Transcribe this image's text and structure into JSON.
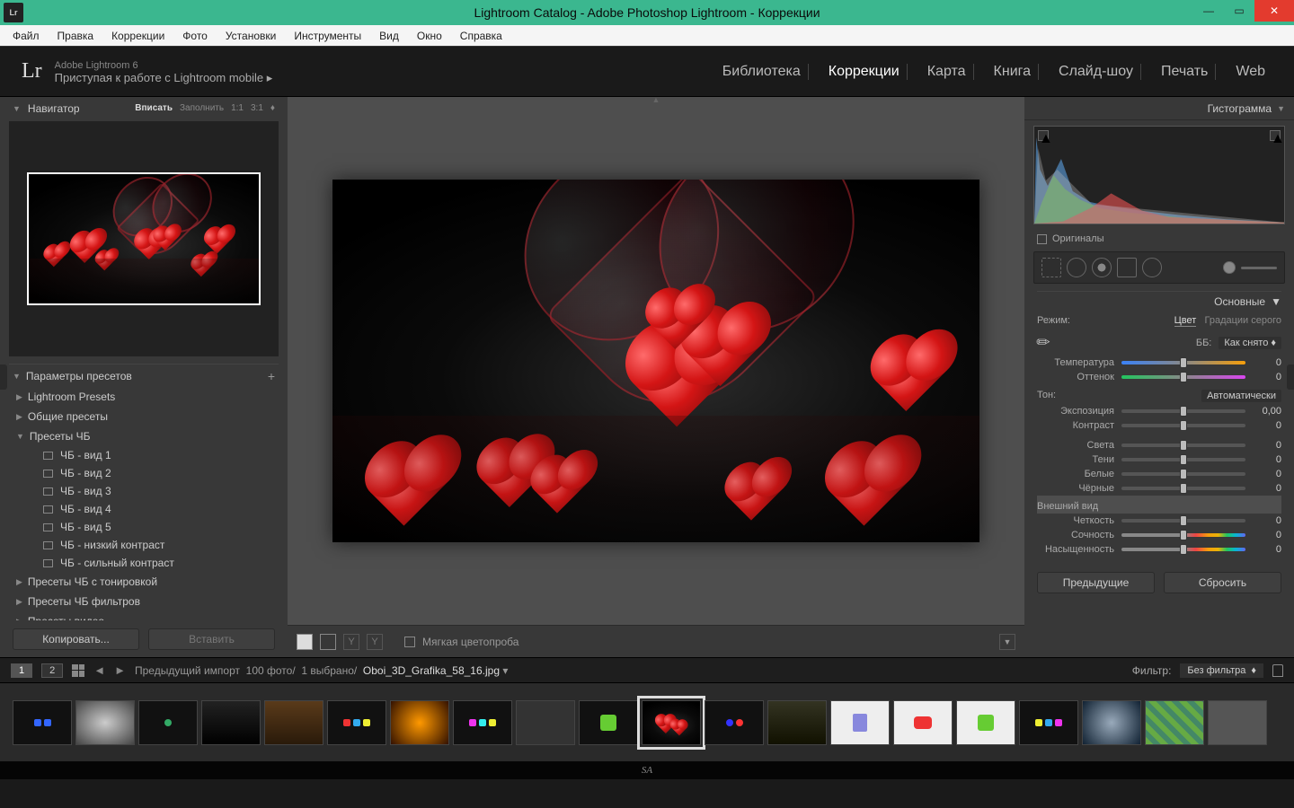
{
  "window": {
    "title": "Lightroom Catalog - Adobe Photoshop Lightroom - Коррекции",
    "app_icon_text": "Lr"
  },
  "menubar": [
    "Файл",
    "Правка",
    "Коррекции",
    "Фото",
    "Установки",
    "Инструменты",
    "Вид",
    "Окно",
    "Справка"
  ],
  "brand": {
    "name": "Adobe Lightroom 6",
    "sub": "Приступая к работе с Lightroom mobile  ▸"
  },
  "modules": [
    {
      "label": "Библиотека",
      "active": false
    },
    {
      "label": "Коррекции",
      "active": true
    },
    {
      "label": "Карта",
      "active": false
    },
    {
      "label": "Книга",
      "active": false
    },
    {
      "label": "Слайд-шоу",
      "active": false
    },
    {
      "label": "Печать",
      "active": false
    },
    {
      "label": "Web",
      "active": false
    }
  ],
  "navigator": {
    "title": "Навигатор",
    "zoom": [
      "Вписать",
      "Заполнить",
      "1:1",
      "3:1"
    ],
    "zoom_active": 0
  },
  "presets": {
    "title": "Параметры пресетов",
    "folders": [
      {
        "label": "Lightroom Presets",
        "open": false
      },
      {
        "label": "Общие пресеты",
        "open": false
      },
      {
        "label": "Пресеты ЧБ",
        "open": true,
        "items": [
          "ЧБ - вид 1",
          "ЧБ - вид 2",
          "ЧБ - вид 3",
          "ЧБ - вид 4",
          "ЧБ - вид 5",
          "ЧБ - низкий контраст",
          "ЧБ - сильный контраст"
        ]
      },
      {
        "label": "Пресеты ЧБ с тонировкой",
        "open": false
      },
      {
        "label": "Пресеты ЧБ фильтров",
        "open": false
      },
      {
        "label": "Пресеты видео",
        "open": false
      }
    ]
  },
  "left_buttons": {
    "copy": "Копировать...",
    "paste": "Вставить"
  },
  "toolbar": {
    "softproof": "Мягкая цветопроба"
  },
  "right": {
    "histogram": "Гистограмма",
    "originals": "Оригиналы",
    "basic_title": "Основные",
    "mode": {
      "label": "Режим:",
      "color": "Цвет",
      "bw": "Градации серого"
    },
    "wb": {
      "label": "ББ:",
      "value": "Как снято"
    },
    "sliders_wb": [
      {
        "label": "Температура",
        "val": "0",
        "track": "temp"
      },
      {
        "label": "Оттенок",
        "val": "0",
        "track": "tint"
      }
    ],
    "tone": {
      "label": "Тон:",
      "auto": "Автоматически"
    },
    "sliders_tone": [
      {
        "label": "Экспозиция",
        "val": "0,00"
      },
      {
        "label": "Контраст",
        "val": "0"
      }
    ],
    "sliders_tone2": [
      {
        "label": "Света",
        "val": "0"
      },
      {
        "label": "Тени",
        "val": "0"
      },
      {
        "label": "Белые",
        "val": "0"
      },
      {
        "label": "Чёрные",
        "val": "0"
      }
    ],
    "presence": "Внешний вид",
    "sliders_presence": [
      {
        "label": "Четкость",
        "val": "0"
      },
      {
        "label": "Сочность",
        "val": "0",
        "track": "sat"
      },
      {
        "label": "Насыщенность",
        "val": "0",
        "track": "sat"
      }
    ]
  },
  "right_buttons": {
    "prev": "Предыдущие",
    "reset": "Сбросить"
  },
  "secbar": {
    "page1": "1",
    "page2": "2",
    "crumb_prefix": "Предыдущий импорт",
    "crumb_count": "100 фото/",
    "crumb_sel": "1 выбрано/",
    "crumb_file": "Oboi_3D_Grafika_58_16.jpg",
    "filter_label": "Фильтр:",
    "filter_value": "Без фильтра"
  },
  "filmstrip_selected_index": 10,
  "bottom": "SA"
}
